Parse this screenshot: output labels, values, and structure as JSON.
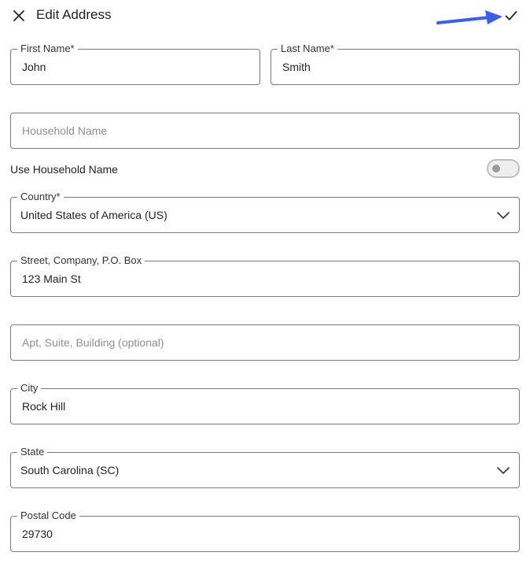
{
  "header": {
    "title": "Edit Address",
    "close_icon": "close-icon",
    "save_icon": "checkmark-icon"
  },
  "annotation": {
    "arrow_color": "#3f5ee6"
  },
  "form": {
    "first_name": {
      "label": "First Name*",
      "value": "John"
    },
    "last_name": {
      "label": "Last Name*",
      "value": "Smith"
    },
    "household_name": {
      "placeholder": "Household Name",
      "value": ""
    },
    "use_household_name": {
      "label": "Use Household Name",
      "enabled": false
    },
    "country": {
      "label": "Country*",
      "value": "United States of America (US)"
    },
    "street": {
      "label": "Street, Company, P.O. Box",
      "value": "123 Main St"
    },
    "apt": {
      "placeholder": "Apt, Suite, Building (optional)",
      "value": ""
    },
    "city": {
      "label": "City",
      "value": "Rock Hill"
    },
    "state": {
      "label": "State",
      "value": "South Carolina (SC)"
    },
    "postal_code": {
      "label": "Postal Code",
      "value": "29730"
    }
  }
}
